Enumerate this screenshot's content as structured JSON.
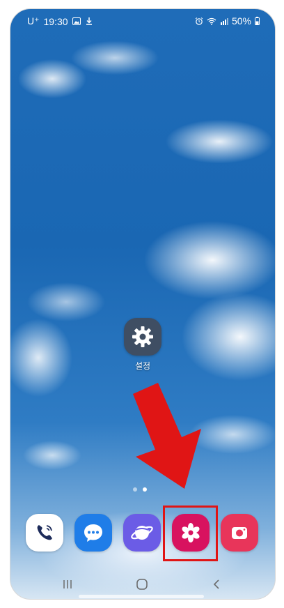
{
  "status_bar": {
    "carrier": "U⁺",
    "time": "19:30",
    "battery": "50%"
  },
  "home": {
    "settings_app": {
      "label": "설정",
      "icon": "gear-icon"
    },
    "page_indicator": {
      "pages": 2,
      "active_page": 2
    }
  },
  "dock": [
    {
      "name": "phone",
      "icon": "phone-icon",
      "color": "#ffffff"
    },
    {
      "name": "messages",
      "icon": "chat-bubble-icon",
      "color": "#1f7de8"
    },
    {
      "name": "internet",
      "icon": "planet-icon",
      "color": "#6b5ce6"
    },
    {
      "name": "gallery",
      "icon": "flower-icon",
      "color": "#d8125f"
    },
    {
      "name": "camera",
      "icon": "camera-icon",
      "color": "#e8355a"
    }
  ],
  "annotation": {
    "arrow_color": "#e01515",
    "highlight_color": "#e01515"
  },
  "nav_bar": {
    "buttons": [
      "recents",
      "home",
      "back"
    ]
  }
}
